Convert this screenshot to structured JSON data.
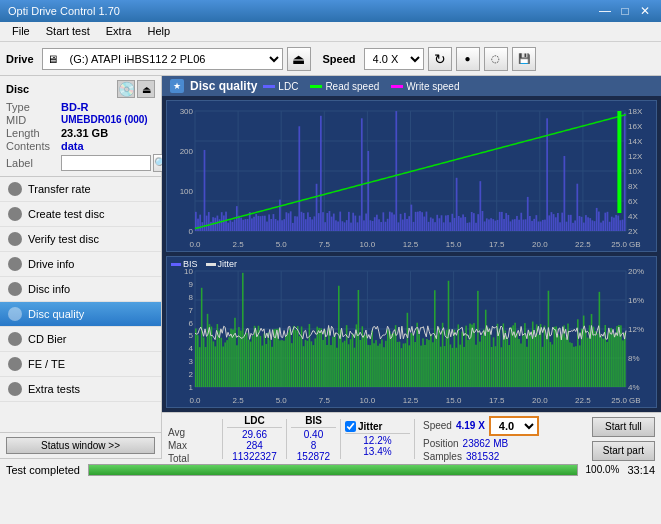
{
  "window": {
    "title": "Opti Drive Control 1.70",
    "minimize": "—",
    "maximize": "□",
    "close": "✕"
  },
  "menu": {
    "items": [
      "File",
      "Start test",
      "Extra",
      "Help"
    ]
  },
  "toolbar": {
    "drive_label": "Drive",
    "drive_value": "(G:)  ATAPI iHBS112  2 PL06",
    "speed_label": "Speed",
    "speed_value": "4.0 X"
  },
  "disc": {
    "type_label": "Type",
    "type_value": "BD-R",
    "mid_label": "MID",
    "mid_value": "UMEBDR016 (000)",
    "length_label": "Length",
    "length_value": "23.31 GB",
    "contents_label": "Contents",
    "contents_value": "data",
    "label_label": "Label"
  },
  "nav": [
    {
      "id": "transfer-rate",
      "label": "Transfer rate"
    },
    {
      "id": "create-test-disc",
      "label": "Create test disc"
    },
    {
      "id": "verify-test-disc",
      "label": "Verify test disc"
    },
    {
      "id": "drive-info",
      "label": "Drive info"
    },
    {
      "id": "disc-info",
      "label": "Disc info"
    },
    {
      "id": "disc-quality",
      "label": "Disc quality",
      "active": true
    },
    {
      "id": "cd-bier",
      "label": "CD Bier"
    },
    {
      "id": "fe-te",
      "label": "FE / TE"
    },
    {
      "id": "extra-tests",
      "label": "Extra tests"
    }
  ],
  "status_window": "Status window >>",
  "panel": {
    "title": "Disc quality",
    "legend": [
      {
        "label": "LDC",
        "color": "#0000ff"
      },
      {
        "label": "Read speed",
        "color": "#00ff00"
      },
      {
        "label": "Write speed",
        "color": "#ff00ff"
      }
    ],
    "legend2": [
      {
        "label": "BIS",
        "color": "#0000ff"
      },
      {
        "label": "Jitter",
        "color": "#ffffff"
      }
    ]
  },
  "stats": {
    "ldc_label": "LDC",
    "bis_label": "BIS",
    "jitter_label": "Jitter",
    "jitter_checked": true,
    "speed_label": "Speed",
    "speed_value": "4.19 X",
    "speed_select": "4.0 X",
    "position_label": "Position",
    "position_value": "23862 MB",
    "samples_label": "Samples",
    "samples_value": "381532",
    "rows": [
      {
        "name": "Avg",
        "ldc": "29.66",
        "bis": "0.40",
        "jitter": "12.2%"
      },
      {
        "name": "Max",
        "ldc": "284",
        "bis": "8",
        "jitter": "13.4%"
      },
      {
        "name": "Total",
        "ldc": "11322327",
        "bis": "152872",
        "jitter": ""
      }
    ],
    "start_full": "Start full",
    "start_part": "Start part"
  },
  "statusbar": {
    "text": "Test completed",
    "progress": 100,
    "progress_pct": "100.0%",
    "time": "33:14"
  },
  "colors": {
    "accent_blue": "#2878c8",
    "chart_bg": "#1e3a6e",
    "grid_line": "#3a5a8a"
  }
}
